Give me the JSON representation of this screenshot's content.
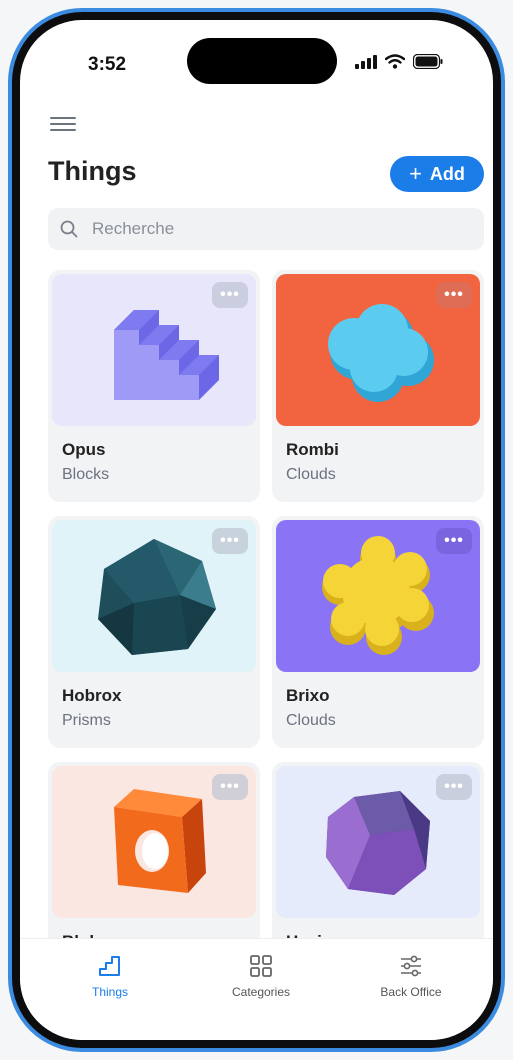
{
  "status_bar": {
    "time": "3:52"
  },
  "header": {
    "title": "Things",
    "add_label": "Add"
  },
  "search": {
    "placeholder": "Recherche"
  },
  "items": [
    {
      "name": "Opus",
      "category": "Blocks",
      "bg": "#e8e6fb",
      "icon": "stairs-3d-shape"
    },
    {
      "name": "Rombi",
      "category": "Clouds",
      "bg": "#f2643f",
      "icon": "cloud-3d-shape"
    },
    {
      "name": "Hobrox",
      "category": "Prisms",
      "bg": "#dff3f8",
      "icon": "polyhedron-3d-shape"
    },
    {
      "name": "Brixo",
      "category": "Clouds",
      "bg": "#8a74f5",
      "icon": "flower-3d-shape"
    },
    {
      "name": "Bloko",
      "category": "",
      "bg": "#fbe7e2",
      "icon": "cube-hole-3d-shape"
    },
    {
      "name": "Hexi",
      "category": "",
      "bg": "#e6ebfb",
      "icon": "hexagon-prism-3d-shape"
    }
  ],
  "nav": {
    "things": "Things",
    "categories": "Categories",
    "back_office": "Back Office"
  },
  "colors": {
    "accent": "#1a7de8",
    "frame": "#3b8be0"
  }
}
